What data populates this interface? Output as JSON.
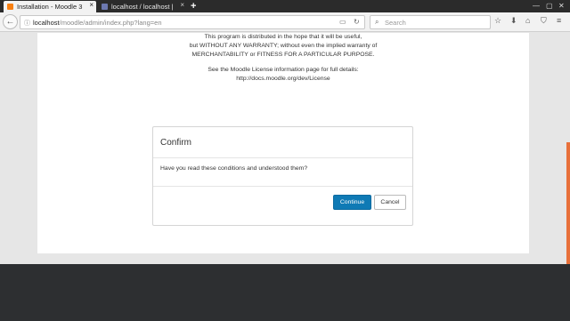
{
  "browser": {
    "tabs": [
      {
        "title": "Installation - Moodle 3",
        "active": true
      },
      {
        "title": "localhost / localhost |",
        "active": false
      }
    ],
    "new_tab": "+",
    "url": {
      "host": "localhost",
      "path": "/moodle/admin/index.php?lang=en"
    },
    "search_placeholder": "Search"
  },
  "page": {
    "license_lines": [
      "This program is distributed in the hope that it will be useful,",
      "but WITHOUT ANY WARRANTY; without even the implied warranty of",
      "MERCHANTABILITY or FITNESS FOR A PARTICULAR PURPOSE."
    ],
    "license_info": [
      "See the Moodle License information page for full details:",
      "http://docs.moodle.org/dev/License"
    ]
  },
  "dialog": {
    "title": "Confirm",
    "message": "Have you read these conditions and understood them?",
    "continue_label": "Continue",
    "cancel_label": "Cancel"
  },
  "colors": {
    "primary_button": "#0f7ab5",
    "moodle_accent": "#e8703a",
    "footer": "#2d2f31"
  }
}
